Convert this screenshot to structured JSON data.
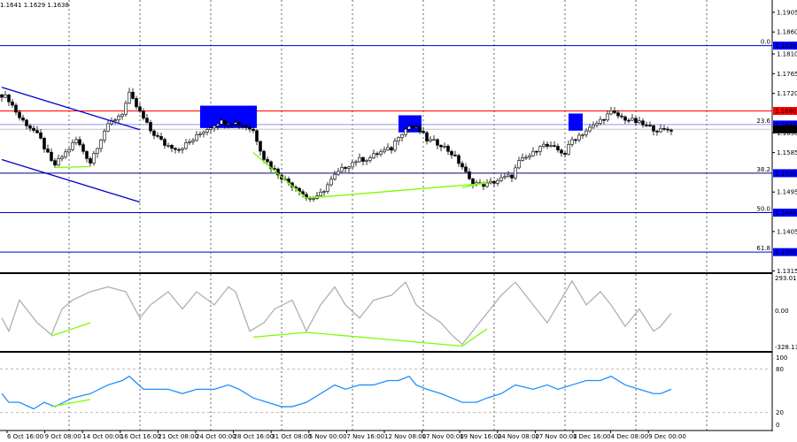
{
  "header": {
    "ohlc_text": "1.1641 1.1629 1.1638"
  },
  "colors": {
    "up": "#000000",
    "down": "#000000",
    "grid": "#000000",
    "rsi": "#1e90ff",
    "cci": "#b0b0b0",
    "divergence": "#7cfc00",
    "fib": "#0000ff",
    "resistance": "#ff0000",
    "zone": "#0000ff"
  },
  "chart_data": [
    {
      "type": "candlestick",
      "title": "",
      "price_axis": {
        "min": 1.1312,
        "max": 1.1933,
        "ticks": [
          "1.1905",
          "1.1860",
          "1.1810",
          "1.1765",
          "1.1720",
          "1.1630",
          "1.1585",
          "1.1495",
          "1.1405",
          "1.1315"
        ]
      },
      "x_tick_labels": [
        "6 Oct 16:00",
        "9 Oct 08:00",
        "14 Oct 00:00",
        "16 Oct 16:00",
        "21 Oct 08:00",
        "24 Oct 00:00",
        "28 Oct 16:00",
        "31 Oct 08:00",
        "5 Nov 00:00",
        "7 Nov 16:00",
        "12 Nov 08:00",
        "17 Nov 00:00",
        "19 Nov 16:00",
        "24 Nov 08:00",
        "27 Nov 00:00",
        "1 Dec 16:00",
        "4 Dec 08:00",
        "9 Dec 00:00"
      ],
      "bars_total": 218,
      "close_path": [
        [
          0,
          1.1717
        ],
        [
          2,
          1.1706
        ],
        [
          5,
          1.1665
        ],
        [
          9,
          1.1635
        ],
        [
          11,
          1.1614
        ],
        [
          14,
          1.1563
        ],
        [
          15,
          1.1557
        ],
        [
          19,
          1.1594
        ],
        [
          21,
          1.1614
        ],
        [
          25,
          1.1563
        ],
        [
          26,
          1.1583
        ],
        [
          29,
          1.1635
        ],
        [
          31,
          1.1655
        ],
        [
          34,
          1.1676
        ],
        [
          36,
          1.1717
        ],
        [
          39,
          1.1676
        ],
        [
          42,
          1.1635
        ],
        [
          46,
          1.1604
        ],
        [
          50,
          1.1594
        ],
        [
          54,
          1.1614
        ],
        [
          57,
          1.1635
        ],
        [
          61,
          1.1655
        ],
        [
          65,
          1.1655
        ],
        [
          69,
          1.1645
        ],
        [
          71,
          1.1635
        ],
        [
          74,
          1.1573
        ],
        [
          76,
          1.1553
        ],
        [
          80,
          1.1522
        ],
        [
          84,
          1.1501
        ],
        [
          86,
          1.1481
        ],
        [
          89,
          1.1481
        ],
        [
          91,
          1.1501
        ],
        [
          94,
          1.1532
        ],
        [
          97,
          1.1553
        ],
        [
          100,
          1.1567
        ],
        [
          104,
          1.1573
        ],
        [
          106,
          1.1583
        ],
        [
          110,
          1.1594
        ],
        [
          112,
          1.1625
        ],
        [
          115,
          1.1645
        ],
        [
          118,
          1.1635
        ],
        [
          120,
          1.1614
        ],
        [
          124,
          1.1604
        ],
        [
          127,
          1.1583
        ],
        [
          130,
          1.1553
        ],
        [
          132,
          1.1522
        ],
        [
          135,
          1.1512
        ],
        [
          137,
          1.1512
        ],
        [
          140,
          1.1522
        ],
        [
          144,
          1.1532
        ],
        [
          146,
          1.1563
        ],
        [
          150,
          1.1583
        ],
        [
          152,
          1.1604
        ],
        [
          156,
          1.1594
        ],
        [
          159,
          1.1583
        ],
        [
          161,
          1.1614
        ],
        [
          165,
          1.1635
        ],
        [
          167,
          1.1645
        ],
        [
          170,
          1.1665
        ],
        [
          172,
          1.1676
        ],
        [
          175,
          1.1665
        ],
        [
          179,
          1.1655
        ],
        [
          182,
          1.1645
        ],
        [
          186,
          1.1635
        ],
        [
          189,
          1.1638
        ]
      ],
      "horizontal_levels": [
        {
          "label": "0.0",
          "price": 1.1829,
          "price_label": "1.1829",
          "kind": "fib"
        },
        {
          "label": "",
          "price": 1.168,
          "price_label": "1.1680",
          "kind": "resistance"
        },
        {
          "label": "23.6",
          "price": 1.1649,
          "price_label": "1.1649",
          "kind": "fib-light"
        },
        {
          "label": "",
          "price": 1.1638,
          "price_label": "1.1638",
          "kind": "current"
        },
        {
          "label": "38.2",
          "price": 1.1538,
          "price_label": "1.1538",
          "kind": "fib-dark"
        },
        {
          "label": "50.0",
          "price": 1.1448,
          "price_label": "1.1448",
          "kind": "fib"
        },
        {
          "label": "61.8",
          "price": 1.1358,
          "price_label": "1.1358",
          "kind": "fib"
        }
      ],
      "zones": [
        [
          56,
          72,
          1.1692,
          1.1641
        ],
        [
          112,
          118.5,
          1.167,
          1.1631
        ],
        [
          160,
          164,
          1.1674,
          1.1635
        ]
      ],
      "trend_lines": [
        [
          0,
          1.1734,
          39,
          1.1637,
          "channel"
        ],
        [
          0,
          1.1569,
          39,
          1.1472,
          "channel"
        ],
        [
          15,
          1.1551,
          25,
          1.1553,
          "divergence"
        ],
        [
          71,
          1.1585,
          86,
          1.1481,
          "divergence"
        ],
        [
          86,
          1.1481,
          137,
          1.1515,
          "divergence"
        ],
        [
          130,
          1.1505,
          137,
          1.1518,
          "divergence"
        ]
      ]
    },
    {
      "type": "line",
      "title": "CCI",
      "ylim": [
        -328.131,
        293.0166
      ],
      "ticks": [
        "293.0166",
        "0.00",
        "-328.131"
      ],
      "values": [
        [
          0,
          -60
        ],
        [
          2,
          -170
        ],
        [
          5,
          90
        ],
        [
          10,
          -100
        ],
        [
          14,
          -200
        ],
        [
          17,
          15
        ],
        [
          20,
          90
        ],
        [
          25,
          160
        ],
        [
          30,
          200
        ],
        [
          35,
          160
        ],
        [
          39,
          -60
        ],
        [
          42,
          50
        ],
        [
          47,
          160
        ],
        [
          51,
          15
        ],
        [
          55,
          160
        ],
        [
          60,
          50
        ],
        [
          64,
          200
        ],
        [
          66,
          160
        ],
        [
          70,
          -170
        ],
        [
          74,
          -100
        ],
        [
          77,
          15
        ],
        [
          82,
          90
        ],
        [
          86,
          -170
        ],
        [
          90,
          50
        ],
        [
          94,
          200
        ],
        [
          97,
          50
        ],
        [
          101,
          -60
        ],
        [
          105,
          90
        ],
        [
          110,
          130
        ],
        [
          114,
          240
        ],
        [
          117,
          50
        ],
        [
          120,
          -20
        ],
        [
          124,
          -100
        ],
        [
          127,
          -200
        ],
        [
          130,
          -280
        ],
        [
          134,
          -130
        ],
        [
          137,
          -20
        ],
        [
          141,
          130
        ],
        [
          145,
          240
        ],
        [
          150,
          50
        ],
        [
          154,
          -100
        ],
        [
          157,
          50
        ],
        [
          161,
          250
        ],
        [
          165,
          50
        ],
        [
          169,
          160
        ],
        [
          172,
          50
        ],
        [
          176,
          -130
        ],
        [
          180,
          15
        ],
        [
          184,
          -170
        ],
        [
          186,
          -130
        ],
        [
          189,
          -20
        ]
      ],
      "divergence_lines": [
        [
          14,
          -210,
          25,
          -100
        ],
        [
          71,
          -220,
          86,
          -180
        ],
        [
          86,
          -180,
          130,
          -295
        ],
        [
          130,
          -295,
          137,
          -150
        ]
      ]
    },
    {
      "type": "line",
      "title": "RSI",
      "ylim": [
        0,
        100
      ],
      "ticks": [
        "100",
        "80",
        "20",
        "0"
      ],
      "values": [
        [
          0,
          46
        ],
        [
          2,
          34
        ],
        [
          5,
          34
        ],
        [
          9,
          25
        ],
        [
          12,
          34
        ],
        [
          15,
          28
        ],
        [
          20,
          40
        ],
        [
          25,
          46
        ],
        [
          30,
          58
        ],
        [
          34,
          64
        ],
        [
          36,
          70
        ],
        [
          40,
          52
        ],
        [
          44,
          52
        ],
        [
          47,
          52
        ],
        [
          51,
          46
        ],
        [
          55,
          52
        ],
        [
          60,
          52
        ],
        [
          64,
          58
        ],
        [
          67,
          52
        ],
        [
          71,
          40
        ],
        [
          75,
          34
        ],
        [
          79,
          28
        ],
        [
          82,
          28
        ],
        [
          86,
          34
        ],
        [
          90,
          46
        ],
        [
          94,
          58
        ],
        [
          97,
          52
        ],
        [
          101,
          58
        ],
        [
          105,
          58
        ],
        [
          109,
          64
        ],
        [
          112,
          64
        ],
        [
          115,
          70
        ],
        [
          117,
          58
        ],
        [
          120,
          52
        ],
        [
          124,
          46
        ],
        [
          127,
          40
        ],
        [
          130,
          34
        ],
        [
          134,
          34
        ],
        [
          137,
          40
        ],
        [
          141,
          46
        ],
        [
          145,
          58
        ],
        [
          150,
          52
        ],
        [
          154,
          58
        ],
        [
          157,
          52
        ],
        [
          161,
          58
        ],
        [
          165,
          64
        ],
        [
          169,
          64
        ],
        [
          172,
          70
        ],
        [
          176,
          58
        ],
        [
          180,
          52
        ],
        [
          184,
          46
        ],
        [
          186,
          46
        ],
        [
          189,
          52
        ]
      ],
      "divergence_lines": [
        [
          14,
          28,
          25,
          38
        ]
      ]
    }
  ]
}
